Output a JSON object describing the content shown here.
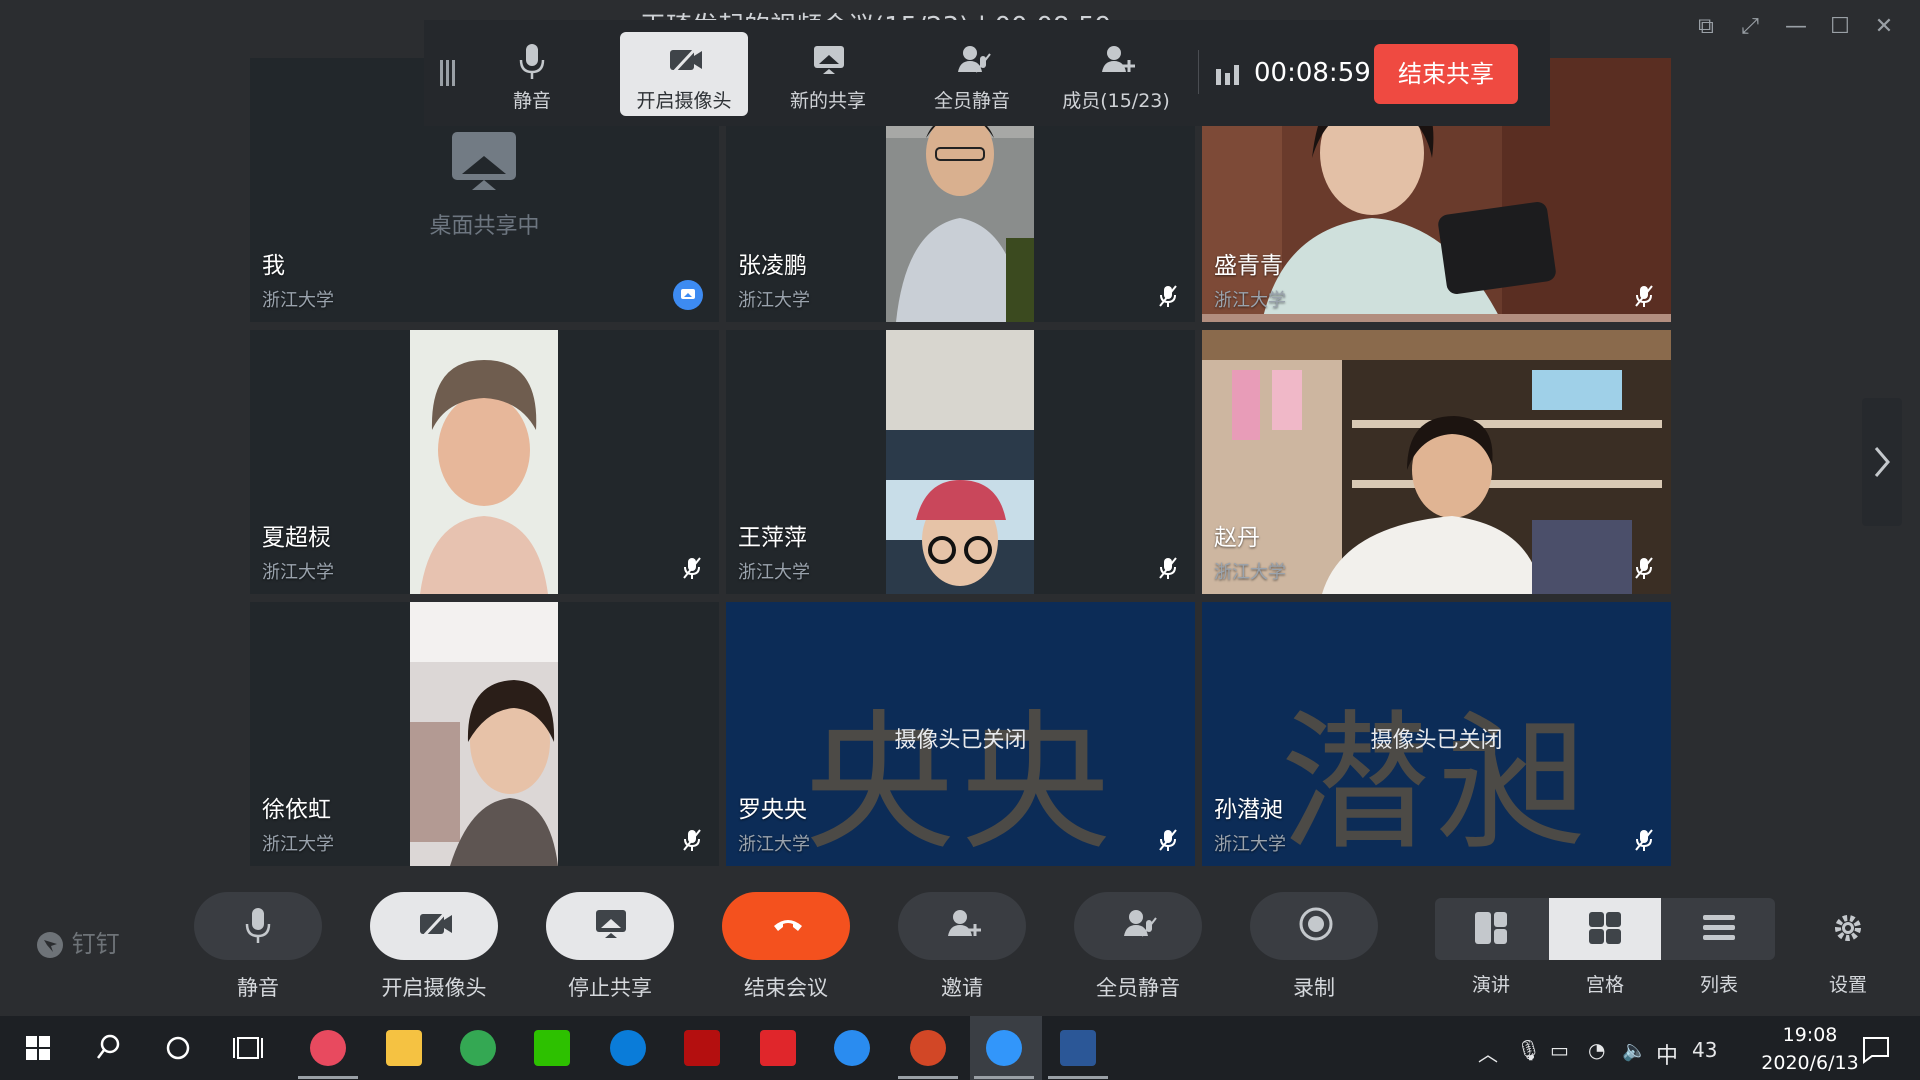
{
  "window": {
    "title": "王琦发起的视频会议(15/23) | 00:08:59",
    "controls": [
      "pin-icon",
      "fullscreen-icon",
      "minimize-icon",
      "maximize-icon",
      "close-icon"
    ]
  },
  "share_toolbar": {
    "buttons": [
      {
        "label": "静音",
        "icon": "microphone-icon"
      },
      {
        "label": "开启摄像头",
        "icon": "camera-off-icon",
        "active": true
      },
      {
        "label": "新的共享",
        "icon": "screen-share-icon"
      },
      {
        "label": "全员静音",
        "icon": "mute-all-icon"
      },
      {
        "label": "成员(15/23)",
        "icon": "add-member-icon"
      }
    ],
    "timer": "00:08:59",
    "end_share_label": "结束共享"
  },
  "participants": [
    {
      "name": "我",
      "org": "浙江大学",
      "status_text": "桌面共享中",
      "mode": "sharing"
    },
    {
      "name": "张凌鹏",
      "org": "浙江大学",
      "mode": "video",
      "muted": true
    },
    {
      "name": "盛青青",
      "org": "浙江大学",
      "mode": "video",
      "muted": true
    },
    {
      "name": "夏超棂",
      "org": "浙江大学",
      "mode": "video",
      "muted": true
    },
    {
      "name": "王萍萍",
      "org": "浙江大学",
      "mode": "video",
      "muted": true
    },
    {
      "name": "赵丹",
      "org": "浙江大学",
      "mode": "video",
      "muted": true
    },
    {
      "name": "徐依虹",
      "org": "浙江大学",
      "mode": "video",
      "muted": true
    },
    {
      "name": "罗央央",
      "org": "浙江大学",
      "mode": "camera-off",
      "big_chars": "央央",
      "status_text": "摄像头已关闭",
      "muted": true
    },
    {
      "name": "孙潜昶",
      "org": "浙江大学",
      "mode": "camera-off",
      "big_chars": "潜昶",
      "status_text": "摄像头已关闭",
      "muted": true
    }
  ],
  "bottom_bar": {
    "logo": "钉钉",
    "buttons": [
      {
        "label": "静音",
        "icon": "microphone-icon"
      },
      {
        "label": "开启摄像头",
        "icon": "camera-off-icon"
      },
      {
        "label": "停止共享",
        "icon": "screen-share-icon"
      },
      {
        "label": "结束会议",
        "icon": "hang-up-icon"
      },
      {
        "label": "邀请",
        "icon": "invite-icon"
      },
      {
        "label": "全员静音",
        "icon": "mute-all-icon"
      },
      {
        "label": "录制",
        "icon": "record-icon"
      }
    ],
    "layouts": [
      {
        "label": "演讲",
        "icon": "speaker-layout-icon"
      },
      {
        "label": "宫格",
        "icon": "grid-layout-icon",
        "active": true
      },
      {
        "label": "列表",
        "icon": "list-layout-icon"
      }
    ],
    "settings_label": "设置"
  },
  "taskbar": {
    "apps": [
      "start-icon",
      "search-icon",
      "cortana-icon",
      "task-view-icon",
      "app-icon",
      "file-explorer-icon",
      "chrome-icon",
      "wechat-icon",
      "edge-icon",
      "acrobat-icon",
      "youdao-icon",
      "feishu-icon",
      "powerpoint-icon",
      "dingtalk-icon",
      "word-icon"
    ],
    "ime": "中",
    "notification_count": "43",
    "time": "19:08",
    "date": "2020/6/13"
  },
  "colors": {
    "accent_red": "#ef4a41",
    "end_meeting": "#f4511e",
    "camera_off_tile": "#0c2c57",
    "share_badge": "#3d8bf2"
  }
}
